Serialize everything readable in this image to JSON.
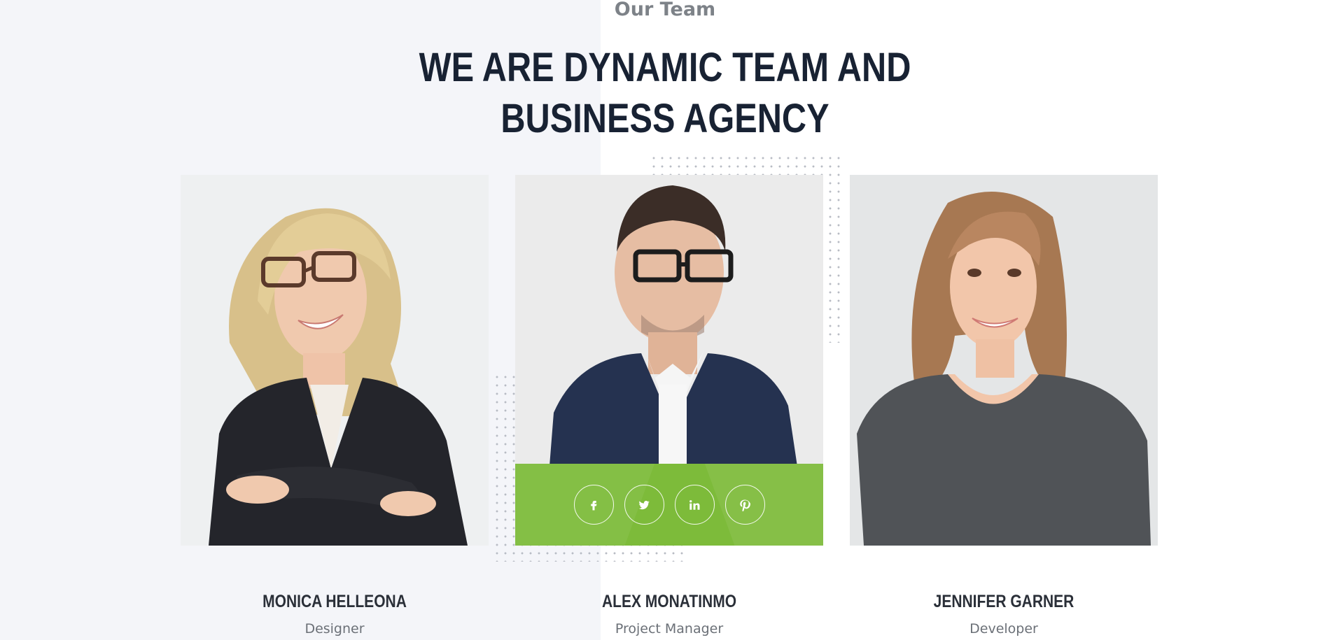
{
  "section": {
    "subtitle": "Our Team",
    "heading_line1": "WE ARE DYNAMIC TEAM AND",
    "heading_line2": "BUSINESS AGENCY"
  },
  "colors": {
    "accent": "#7dbb3a",
    "heading": "#182233",
    "subtitle": "#7d8288",
    "left_background": "#f4f5f9"
  },
  "team": [
    {
      "name": "MONICA HELLEONA",
      "role": "Designer",
      "photo": "blonde-woman-glasses-portrait"
    },
    {
      "name": "ALEX MONATINMO",
      "role": "Project Manager",
      "photo": "man-glasses-suit-portrait"
    },
    {
      "name": "JENNIFER GARNER",
      "role": "Developer",
      "photo": "young-woman-tshirt-portrait"
    }
  ],
  "social": [
    {
      "icon": "facebook-icon",
      "glyph": "f"
    },
    {
      "icon": "twitter-icon",
      "glyph": ""
    },
    {
      "icon": "linkedin-icon",
      "glyph": "in"
    },
    {
      "icon": "pinterest-icon",
      "glyph": ""
    }
  ]
}
